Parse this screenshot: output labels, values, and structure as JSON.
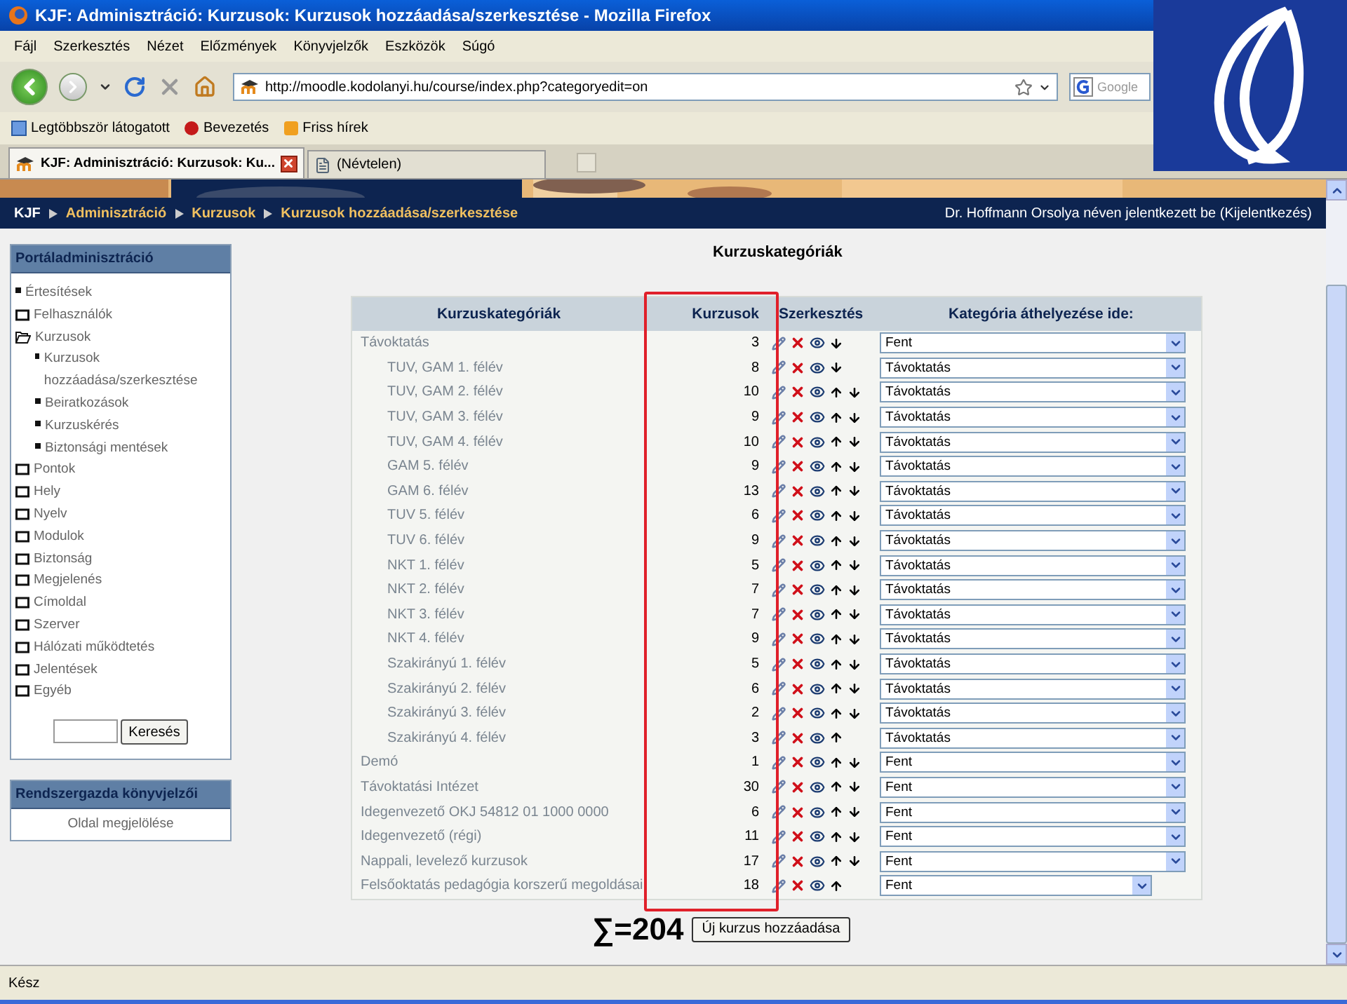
{
  "window": {
    "title": "KJF: Adminisztráció: Kurzusok: Kurzusok hozzáadása/szerkesztése - Mozilla Firefox"
  },
  "menu": [
    "Fájl",
    "Szerkesztés",
    "Nézet",
    "Előzmények",
    "Könyvjelzők",
    "Eszközök",
    "Súgó"
  ],
  "address_bar": {
    "value": "http://moodle.kodolanyi.hu/course/index.php?categoryedit=on"
  },
  "search_field": {
    "placeholder": "Google"
  },
  "bookmarks": [
    "Legtöbbször látogatott",
    "Bevezetés",
    "Friss hírek"
  ],
  "tabs": [
    {
      "label": "KJF: Adminisztráció: Kurzusok: Ku...",
      "selected": true
    },
    {
      "label": "(Névtelen)",
      "selected": false
    }
  ],
  "breadcrumb": [
    "KJF",
    "Adminisztráció",
    "Kurzusok",
    "Kurzusok hozzáadása/szerkesztése"
  ],
  "login_info": {
    "text": "Dr. Hoffmann Orsolya néven jelentkezett be",
    "link": "(Kijelentkezés)"
  },
  "sidebar": {
    "title": "Portáladminisztráció",
    "items": [
      {
        "label": "Értesítések",
        "kind": "item"
      },
      {
        "label": "Felhasználók",
        "kind": "folder",
        "expanded": false
      },
      {
        "label": "Kurzusok",
        "kind": "folder",
        "expanded": true,
        "children": [
          {
            "label": "Kurzusok hozzáadása/szerkesztése",
            "kind": "item"
          },
          {
            "label": "Beiratkozások",
            "kind": "item"
          },
          {
            "label": "Kurzuskérés",
            "kind": "item"
          },
          {
            "label": "Biztonsági mentések",
            "kind": "item"
          }
        ]
      },
      {
        "label": "Pontok",
        "kind": "folder",
        "expanded": false
      },
      {
        "label": "Hely",
        "kind": "folder",
        "expanded": false
      },
      {
        "label": "Nyelv",
        "kind": "folder",
        "expanded": false
      },
      {
        "label": "Modulok",
        "kind": "folder",
        "expanded": false
      },
      {
        "label": "Biztonság",
        "kind": "folder",
        "expanded": false
      },
      {
        "label": "Megjelenés",
        "kind": "folder",
        "expanded": false
      },
      {
        "label": "Címoldal",
        "kind": "folder",
        "expanded": false
      },
      {
        "label": "Szerver",
        "kind": "folder",
        "expanded": false
      },
      {
        "label": "Hálózati működtetés",
        "kind": "folder",
        "expanded": false
      },
      {
        "label": "Jelentések",
        "kind": "folder",
        "expanded": false
      },
      {
        "label": "Egyéb",
        "kind": "folder",
        "expanded": false
      }
    ],
    "search_button": "Keresés"
  },
  "admin_bookmarks": {
    "title": "Rendszergazda könyvjelzői",
    "link": "Oldal megjelölése"
  },
  "page_title": "Kurzuskategóriák",
  "table": {
    "columns": [
      "Kurzuskategóriák",
      "Kurzusok",
      "Szerkesztés",
      "Kategória áthelyezése ide:"
    ],
    "rows": [
      {
        "name": "Távoktatás",
        "count": "3",
        "up": false,
        "down": true,
        "move_to": "Fent",
        "children": [
          {
            "name": "TUV, GAM 1. félév",
            "count": "8",
            "up": false,
            "down": true,
            "move_to": "Távoktatás"
          },
          {
            "name": "TUV, GAM 2. félév",
            "count": "10",
            "up": true,
            "down": true,
            "move_to": "Távoktatás"
          },
          {
            "name": "TUV, GAM 3. félév",
            "count": "9",
            "up": true,
            "down": true,
            "move_to": "Távoktatás"
          },
          {
            "name": "TUV, GAM 4. félév",
            "count": "10",
            "up": true,
            "down": true,
            "move_to": "Távoktatás"
          },
          {
            "name": "GAM 5. félév",
            "count": "9",
            "up": true,
            "down": true,
            "move_to": "Távoktatás"
          },
          {
            "name": "GAM 6. félév",
            "count": "13",
            "up": true,
            "down": true,
            "move_to": "Távoktatás"
          },
          {
            "name": "TUV 5. félév",
            "count": "6",
            "up": true,
            "down": true,
            "move_to": "Távoktatás"
          },
          {
            "name": "TUV 6. félév",
            "count": "9",
            "up": true,
            "down": true,
            "move_to": "Távoktatás"
          },
          {
            "name": "NKT 1. félév",
            "count": "5",
            "up": true,
            "down": true,
            "move_to": "Távoktatás"
          },
          {
            "name": "NKT 2. félév",
            "count": "7",
            "up": true,
            "down": true,
            "move_to": "Távoktatás"
          },
          {
            "name": "NKT 3. félév",
            "count": "7",
            "up": true,
            "down": true,
            "move_to": "Távoktatás"
          },
          {
            "name": "NKT 4. félév",
            "count": "9",
            "up": true,
            "down": true,
            "move_to": "Távoktatás"
          },
          {
            "name": "Szakirányú 1. félév",
            "count": "5",
            "up": true,
            "down": true,
            "move_to": "Távoktatás"
          },
          {
            "name": "Szakirányú 2. félév",
            "count": "6",
            "up": true,
            "down": true,
            "move_to": "Távoktatás"
          },
          {
            "name": "Szakirányú 3. félév",
            "count": "2",
            "up": true,
            "down": true,
            "move_to": "Távoktatás"
          },
          {
            "name": "Szakirányú 4. félév",
            "count": "3",
            "up": true,
            "down": false,
            "move_to": "Távoktatás"
          }
        ]
      },
      {
        "name": "Demó",
        "count": "1",
        "up": true,
        "down": true,
        "move_to": "Fent"
      },
      {
        "name": "Távoktatási Intézet",
        "count": "30",
        "up": true,
        "down": true,
        "move_to": "Fent"
      },
      {
        "name": "Idegenvezető OKJ 54812 01 1000 0000",
        "count": "6",
        "up": true,
        "down": true,
        "move_to": "Fent"
      },
      {
        "name": "Idegenvezető (régi)",
        "count": "11",
        "up": true,
        "down": true,
        "move_to": "Fent"
      },
      {
        "name": "Nappali, levelező kurzusok",
        "count": "17",
        "up": true,
        "down": true,
        "move_to": "Fent"
      },
      {
        "name": "Felsőoktatás pedagógia korszerű megoldásai",
        "count": "18",
        "up": true,
        "down": false,
        "move_to": "Fent"
      }
    ]
  },
  "total": "∑=204",
  "add_button": "Új kurzus hozzáadása",
  "status_bar": "Kész"
}
